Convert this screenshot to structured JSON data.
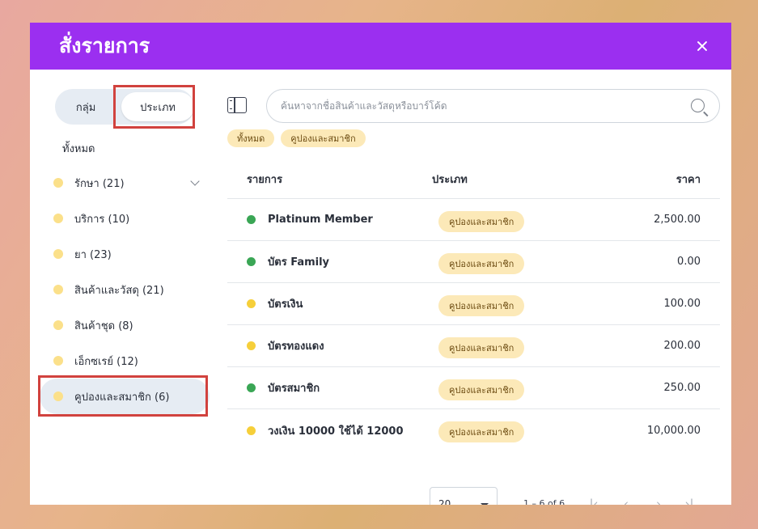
{
  "modal": {
    "title": "สั่งรายการ",
    "close_label": "✕"
  },
  "left": {
    "toggle": {
      "group_label": "กลุ่ม",
      "type_label": "ประเภท"
    },
    "all_label": "ทั้งหมด",
    "categories": [
      {
        "label": "รักษา (21)"
      },
      {
        "label": "บริการ (10)"
      },
      {
        "label": "ยา (23)"
      },
      {
        "label": "สินค้าและวัสดุ (21)"
      },
      {
        "label": "สินค้าชุด (8)"
      },
      {
        "label": "เอ็กซเรย์ (12)"
      },
      {
        "label": "คูปองและสมาชิก (6)"
      }
    ]
  },
  "search": {
    "placeholder": "ค้นหาจากชื่อสินค้าและวัสดุหรือบาร์โค้ด"
  },
  "chips": [
    "ทั้งหมด",
    "คูปองและสมาชิก"
  ],
  "table": {
    "headers": {
      "name": "รายการ",
      "type": "ประเภท",
      "price": "ราคา"
    },
    "rows": [
      {
        "name": "Platinum Member",
        "type": "คูปองและสมาชิก",
        "price": "2,500.00",
        "status_color": "#3aa655"
      },
      {
        "name": "บัตร Family",
        "type": "คูปองและสมาชิก",
        "price": "0.00",
        "status_color": "#3aa655"
      },
      {
        "name": "บัตรเงิน",
        "type": "คูปองและสมาชิก",
        "price": "100.00",
        "status_color": "#f6cf3a"
      },
      {
        "name": "บัตรทองแดง",
        "type": "คูปองและสมาชิก",
        "price": "200.00",
        "status_color": "#f6cf3a"
      },
      {
        "name": "บัตรสมาชิก",
        "type": "คูปองและสมาชิก",
        "price": "250.00",
        "status_color": "#3aa655"
      },
      {
        "name": "วงเงิน 10000 ใช้ได้ 12000",
        "type": "คูปองและสมาชิก",
        "price": "10,000.00",
        "status_color": "#f6cf3a"
      }
    ]
  },
  "pager": {
    "page_size": "20",
    "range": "1 – 6 of 6",
    "first": "|‹",
    "prev": "‹",
    "next": "›",
    "last": "›|"
  },
  "colors": {
    "header": "#9b2ff0",
    "chip_bg": "#fce9b8",
    "highlight": "#d1423e"
  }
}
